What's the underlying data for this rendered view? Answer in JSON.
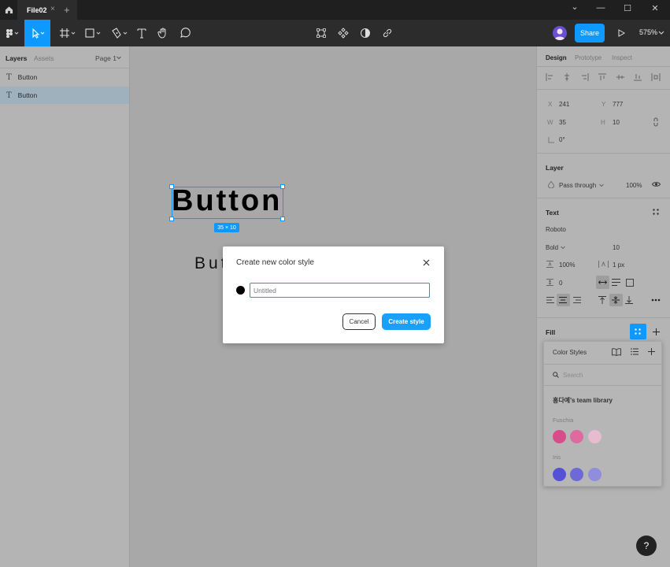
{
  "titlebar": {
    "tab_title": "File02",
    "tab_close": "×",
    "new_tab": "+",
    "minimize": "⌄",
    "maximize_1": "—",
    "maximize_2": "☐",
    "close": "✕"
  },
  "toolbar": {
    "share_label": "Share",
    "zoom_label": "575%"
  },
  "left_panel": {
    "tabs": [
      "Layers",
      "Assets"
    ],
    "page_label": "Page 1",
    "layers": [
      {
        "name": "Button",
        "selected": false
      },
      {
        "name": "Button",
        "selected": true
      }
    ]
  },
  "canvas": {
    "big_text": "Button",
    "small_text": "But",
    "dimension_badge": "35 × 10"
  },
  "modal": {
    "title": "Create new color style",
    "placeholder": "Untitled",
    "cancel_label": "Cancel",
    "create_label": "Create style"
  },
  "right_panel": {
    "tabs": [
      "Design",
      "Prototype",
      "Inspect"
    ],
    "position": {
      "x_label": "X",
      "x_value": "241",
      "y_label": "Y",
      "y_value": "777"
    },
    "size": {
      "w_label": "W",
      "w_value": "35",
      "h_label": "H",
      "h_value": "10"
    },
    "rotation": "0°",
    "layer": {
      "heading": "Layer",
      "blend": "Pass through",
      "opacity": "100%"
    },
    "text": {
      "heading": "Text",
      "font": "Roboto",
      "weight": "Bold",
      "size": "10",
      "line_height": "100%",
      "letter_spacing": "1 px",
      "paragraph_spacing": "0"
    },
    "fill": {
      "heading": "Fill"
    }
  },
  "color_styles_popup": {
    "title": "Color Styles",
    "search_placeholder": "Search",
    "library": "홍다예's team library",
    "groups": [
      {
        "name": "Fuschia",
        "colors": [
          "#d94c8a",
          "#de6aa0",
          "#e8bcd0"
        ]
      },
      {
        "name": "Iris",
        "colors": [
          "#5551d6",
          "#6d6ad8",
          "#908ddc"
        ]
      }
    ]
  },
  "help_label": "?"
}
